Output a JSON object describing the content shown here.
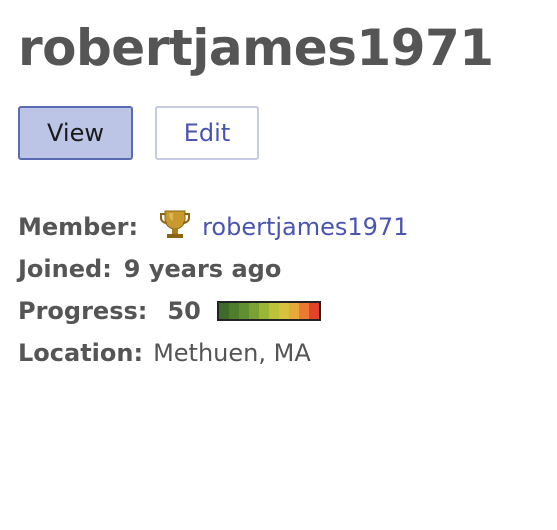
{
  "profile": {
    "username": "robertjames1971"
  },
  "tabs": {
    "view_label": "View",
    "edit_label": "Edit"
  },
  "fields": {
    "member_label": "Member:",
    "member_value": "robertjames1971",
    "member_icon": "trophy-icon",
    "joined_label": "Joined:",
    "joined_value": "9 years ago",
    "progress_label": "Progress:",
    "progress_value": "50",
    "progress_colors": [
      "#3f6b2a",
      "#4f7d2c",
      "#5f8f2e",
      "#7aa232",
      "#9bb536",
      "#bcc33a",
      "#d6c23c",
      "#e8a93a",
      "#ec7a30",
      "#e2432a"
    ],
    "location_label": "Location:",
    "location_value": "Methuen, MA"
  },
  "colors": {
    "title": "#555555",
    "link": "#4a55b0",
    "active_tab_bg": "#bcc5e5",
    "active_tab_border": "#5a6cb4"
  }
}
